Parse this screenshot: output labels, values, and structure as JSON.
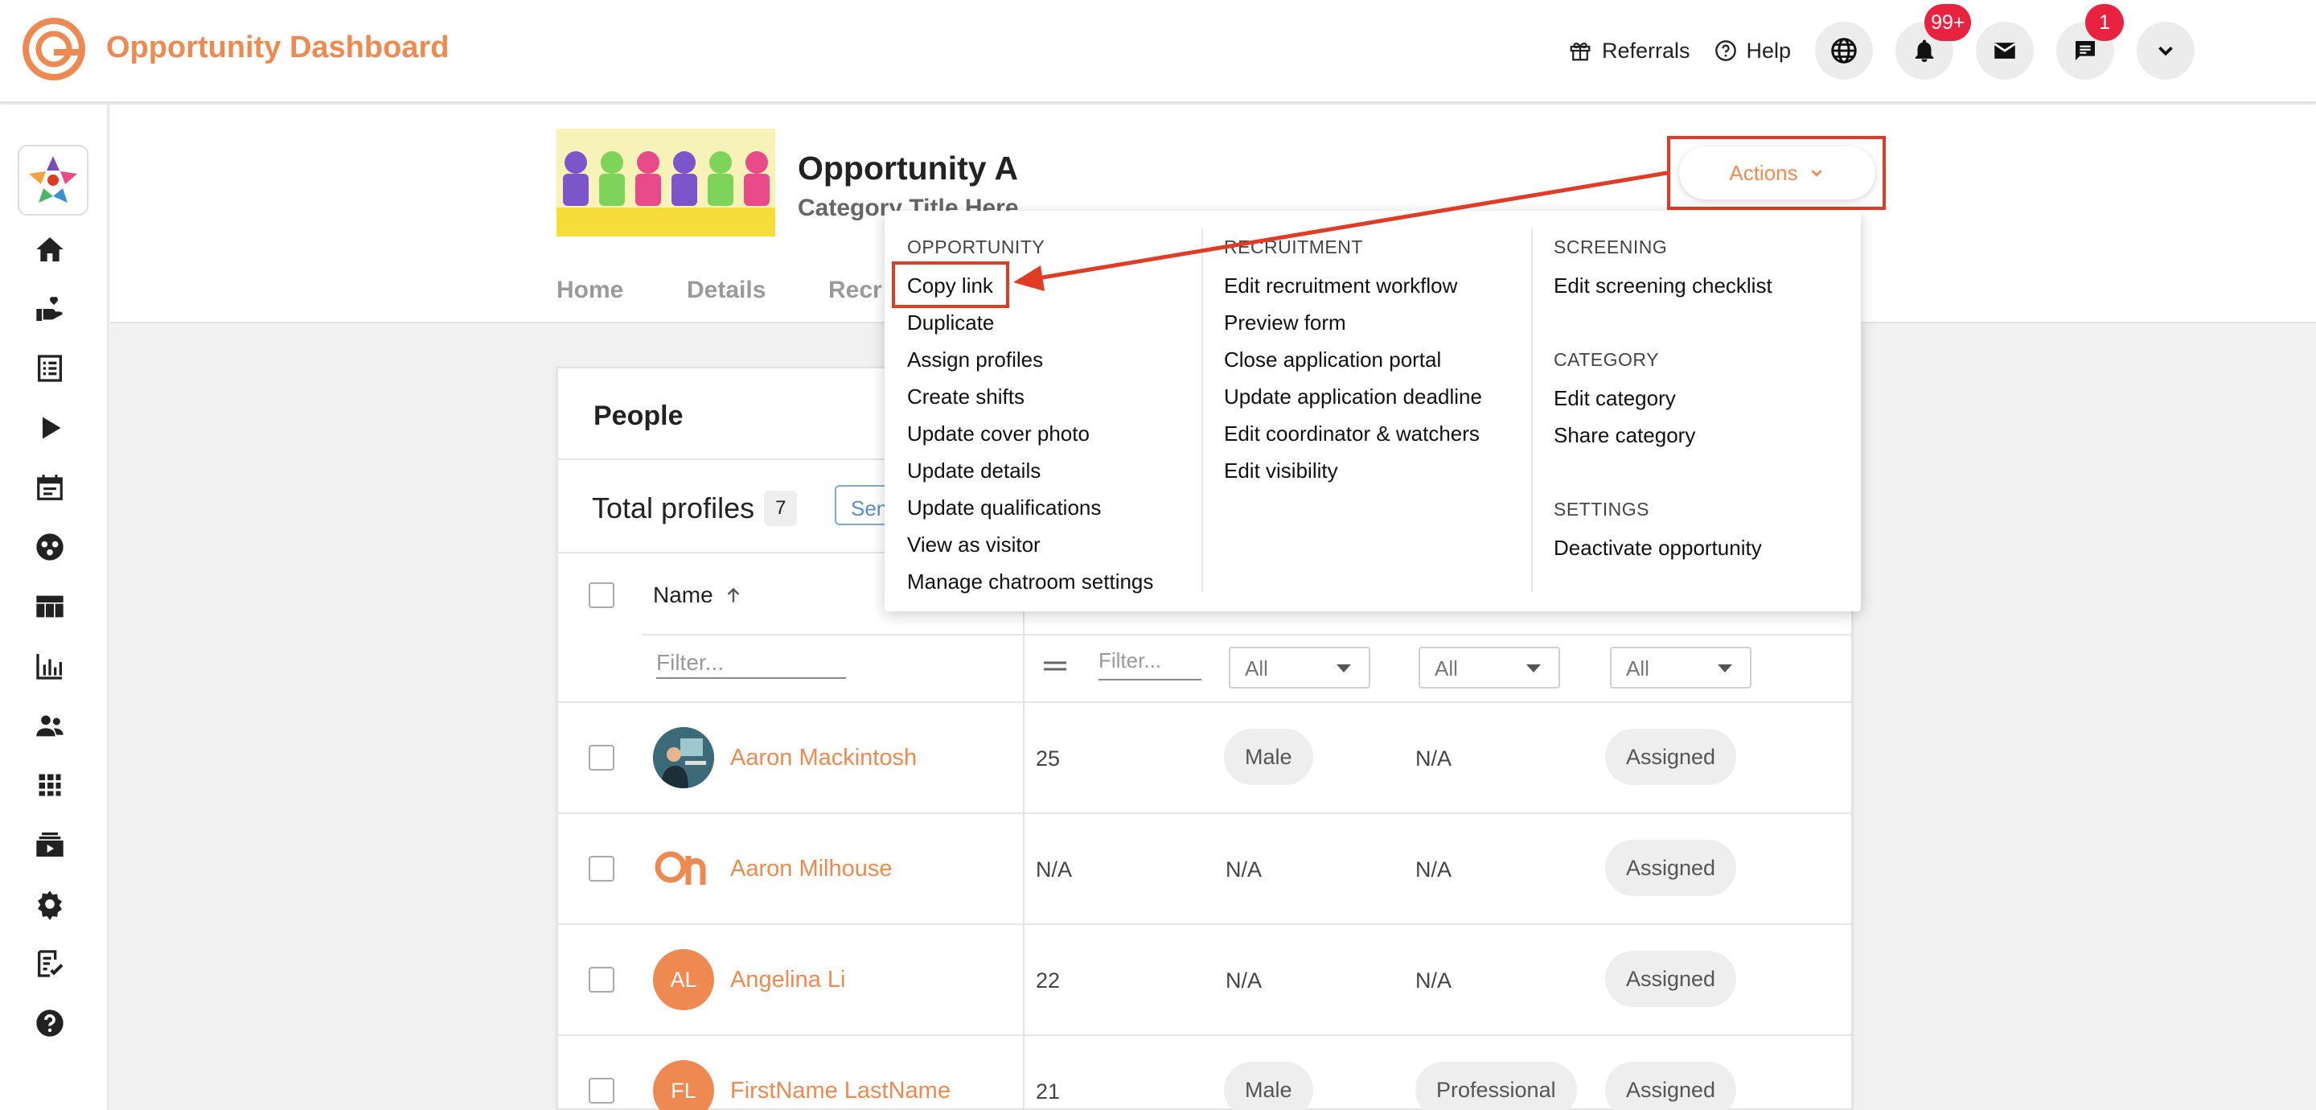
{
  "app": {
    "title": "Opportunity Dashboard"
  },
  "topnav": {
    "referrals": "Referrals",
    "help": "Help",
    "notifications_badge": "99+",
    "chat_badge": "1"
  },
  "opportunity": {
    "title": "Opportunity A",
    "subtitle": "Category Title Here"
  },
  "tabs": [
    "Home",
    "Details",
    "Recr"
  ],
  "actions_label": "Actions",
  "menu": {
    "opportunity": {
      "header": "OPPORTUNITY",
      "items": [
        "Copy link",
        "Duplicate",
        "Assign profiles",
        "Create shifts",
        "Update cover photo",
        "Update details",
        "Update qualifications",
        "View as visitor",
        "Manage chatroom settings"
      ]
    },
    "recruitment": {
      "header": "RECRUITMENT",
      "items": [
        "Edit recruitment workflow",
        "Preview form",
        "Close application portal",
        "Update application deadline",
        "Edit coordinator & watchers",
        "Edit visibility"
      ]
    },
    "screening": {
      "header": "SCREENING",
      "items": [
        "Edit screening checklist"
      ]
    },
    "category": {
      "header": "CATEGORY",
      "items": [
        "Edit category",
        "Share category"
      ]
    },
    "settings": {
      "header": "SETTINGS",
      "items": [
        "Deactivate opportunity"
      ]
    }
  },
  "people": {
    "title": "People",
    "total_label": "Total profiles",
    "total_count": "7",
    "send_label": "Sen",
    "name_header": "Name",
    "name_filter_placeholder": "Filter...",
    "age_filter_placeholder": "Filter...",
    "select_all": "All",
    "rows": [
      {
        "name": "Aaron Mackintosh",
        "initials": "",
        "age": "25",
        "gender": "Male",
        "qualification": "N/A",
        "status": "Assigned"
      },
      {
        "name": "Aaron Milhouse",
        "initials": "",
        "age": "N/A",
        "gender": "N/A",
        "qualification": "N/A",
        "status": "Assigned"
      },
      {
        "name": "Angelina Li",
        "initials": "AL",
        "age": "22",
        "gender": "N/A",
        "qualification": "N/A",
        "status": "Assigned"
      },
      {
        "name": "FirstName LastName",
        "initials": "FL",
        "age": "21",
        "gender": "Male",
        "qualification": "Professional",
        "status": "Assigned"
      }
    ]
  },
  "colors": {
    "accent": "#ee8a51",
    "highlight": "#e03b24",
    "badge": "#e8233f"
  }
}
